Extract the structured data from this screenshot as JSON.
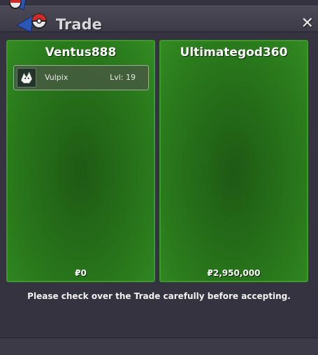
{
  "window": {
    "title": "Trade",
    "close_glyph": "✕"
  },
  "icons": {
    "logo": "pokeball-logo-icon",
    "close": "close-icon",
    "pokemon": "vulpix-sprite-icon"
  },
  "colors": {
    "panel_green": "#2a7a1c",
    "panel_border": "#3a9a2a",
    "window_bg": "#34333f"
  },
  "left_panel": {
    "player": "Ventus888",
    "offers": [
      {
        "pokemon": "Vulpix",
        "level": "Lvl: 19"
      }
    ],
    "money": "₽0"
  },
  "right_panel": {
    "player": "Ultimategod360",
    "offers": [],
    "money": "₽2,950,000"
  },
  "footer": {
    "notice": "Please check over the Trade carefully before accepting."
  }
}
